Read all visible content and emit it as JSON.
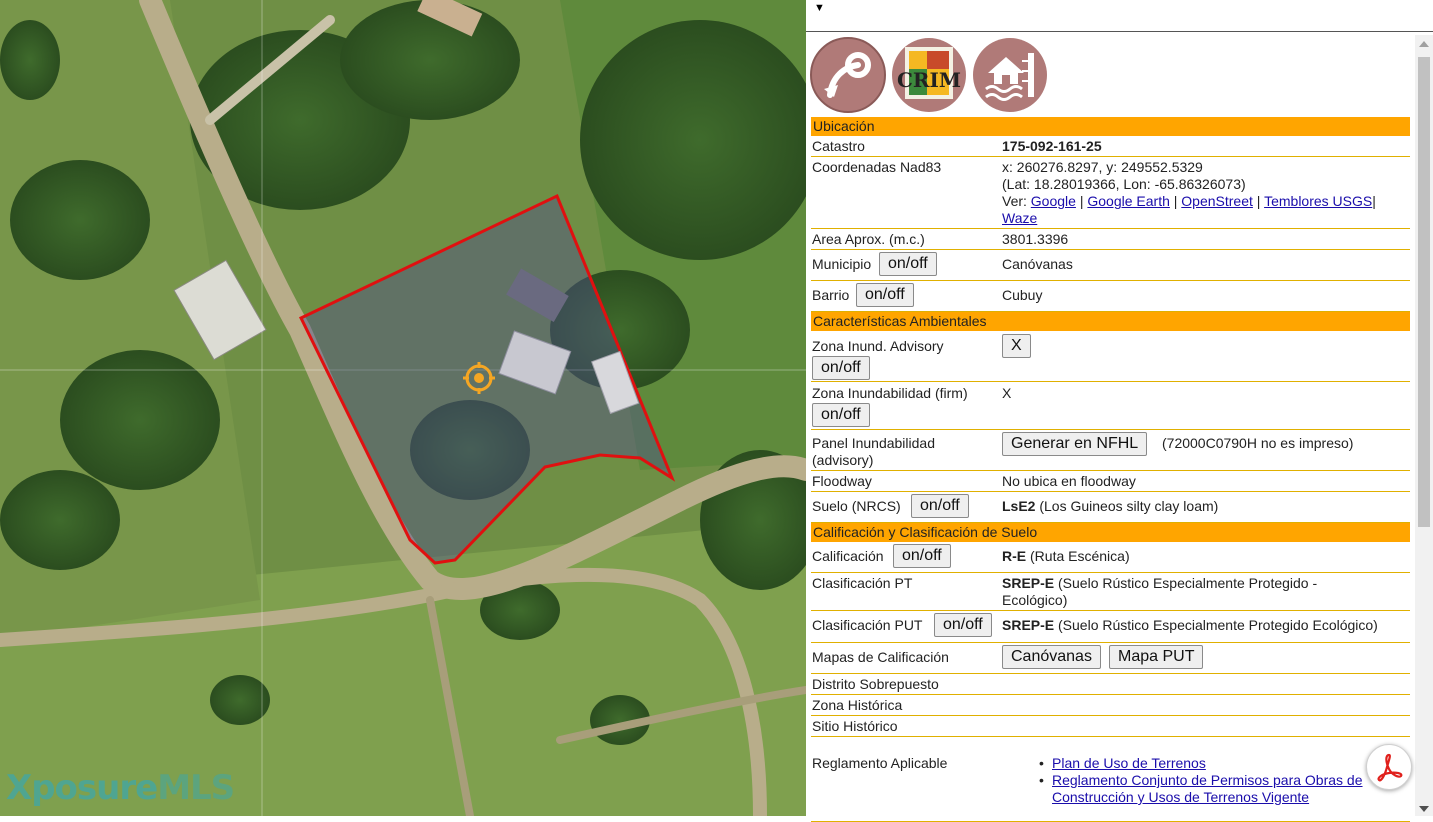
{
  "map": {
    "watermark_part1": "Xposure",
    "watermark_part2": "MLS"
  },
  "panel": {
    "collapse_icon": "caret-down-icon",
    "logos": [
      "share-arrow-logo",
      "crim-logo",
      "flood-house-logo"
    ],
    "crim_text": "CRIM",
    "sections": {
      "ubicacion": "Ubicación",
      "ambientales": "Características Ambientales",
      "calificacion": "Calificación y Clasificación de Suelo"
    },
    "rows": {
      "catastro_label": "Catastro",
      "catastro_value": "175-092-161-25",
      "coords_label": "Coordenadas Nad83",
      "coords_xy": "x: 260276.8297, y: 249552.5329",
      "coords_latlon": "(Lat: 18.28019366, Lon: -65.86326073)",
      "ver_label": "Ver:",
      "link_google": "Google",
      "link_google_earth": "Google Earth",
      "link_openstreet": "OpenStreet",
      "link_temblores": "Temblores USGS",
      "link_waze": "Waze",
      "sep": "|",
      "area_label": "Area Aprox. (m.c.)",
      "area_value": "3801.3396",
      "municipio_label": "Municipio",
      "municipio_value": "Canóvanas",
      "barrio_label": "Barrio",
      "barrio_value": "Cubuy",
      "onoff": "on/off",
      "zona_advisory_label": "Zona Inund. Advisory",
      "x_button": "X",
      "zona_firm_label": "Zona Inundabilidad (firm)",
      "zona_firm_value": "X",
      "panel_label_1": "Panel Inundabilidad",
      "panel_label_2": "(advisory)",
      "generar_button": "Generar en NFHL",
      "panel_note": "(72000C0790H no es impreso)",
      "floodway_label": "Floodway",
      "floodway_value": "No ubica en floodway",
      "suelo_label": "Suelo (NRCS)",
      "suelo_code": "LsE2",
      "suelo_desc": "(Los Guineos silty clay loam)",
      "calif_label": "Calificación",
      "calif_code": "R-E",
      "calif_desc": "(Ruta Escénica)",
      "clas_pt_label": "Clasificación PT",
      "clas_pt_code": "SREP-E",
      "clas_pt_desc": "(Suelo Rústico Especialmente Protegido -",
      "clas_pt_desc2": "Ecológico)",
      "clas_put_label": "Clasificación PUT",
      "clas_put_code": "SREP-E",
      "clas_put_desc": "(Suelo Rústico Especialmente Protegido Ecológico)",
      "mapas_label": "Mapas de Calificación",
      "mapas_btn1": "Canóvanas",
      "mapas_btn2": "Mapa PUT",
      "distrito_label": "Distrito Sobrepuesto",
      "zona_hist_label": "Zona Histórica",
      "sitio_hist_label": "Sitio Histórico",
      "reglamento_label": "Reglamento Aplicable",
      "reglamento_link1": "Plan de Uso de Terrenos",
      "reglamento_link2a": "Reglamento Conjunto de Permisos para Obras de",
      "reglamento_link2b": "Construcción y Usos de Terrenos Vigente"
    },
    "pdf_icon": "pdf-icon",
    "colors": {
      "section_header": "#ffa500",
      "row_border": "#e0b000",
      "parcel_outline": "#e01010",
      "link": "#1a0dab"
    }
  }
}
